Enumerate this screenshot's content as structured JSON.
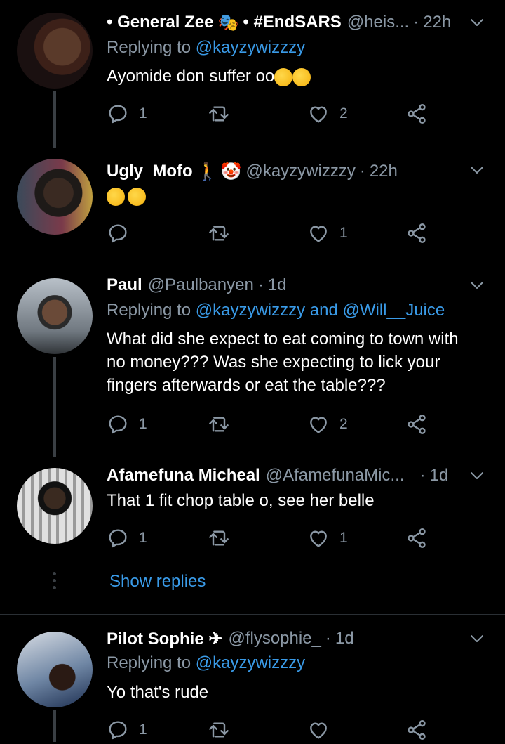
{
  "colors": {
    "background": "#000000",
    "text": "#ffffff",
    "muted": "#8b98a5",
    "link": "#3a9be8",
    "thread_line": "#3a3f44"
  },
  "tweets": [
    {
      "display_name": "• General Zee",
      "name_suffix": "• #EndSARS",
      "handle": "@heis...",
      "time": "22h",
      "reply_prefix": "Replying to",
      "reply_handles": "@kayzywizzzy",
      "text": "Ayomide don suffer oo",
      "text_emojis": [
        "rofl-emoji",
        "rofl-emoji"
      ],
      "replies": "1",
      "retweets": "",
      "likes": "2"
    },
    {
      "display_name": "Ugly_Mofo",
      "name_suffix": "",
      "handle": "@kayzywizzzy",
      "time": "22h",
      "text": "",
      "text_emojis": [
        "tears-of-joy-emoji",
        "tears-of-joy-emoji"
      ],
      "replies": "",
      "retweets": "",
      "likes": "1"
    },
    {
      "display_name": "Paul",
      "handle": "@Paulbanyen",
      "time": "1d",
      "reply_prefix": "Replying to",
      "reply_handles": "@kayzywizzzy and @Will__Juice",
      "text": "What did she expect to eat coming to town with no money??? Was she expecting to lick your fingers afterwards or eat the table???",
      "replies": "1",
      "retweets": "",
      "likes": "2"
    },
    {
      "display_name": "Afamefuna Micheal",
      "handle": "@AfamefunaMic...",
      "time": "1d",
      "text": "That 1 fit chop table o, see her belle",
      "replies": "1",
      "retweets": "",
      "likes": "1"
    },
    {
      "display_name": "Pilot Sophie ✈",
      "handle": "@flysophie_",
      "time": "1d",
      "reply_prefix": "Replying to",
      "reply_handles": "@kayzywizzzy",
      "text": "Yo that's rude",
      "replies": "1",
      "retweets": "",
      "likes": ""
    }
  ],
  "show_replies_label": "Show replies"
}
